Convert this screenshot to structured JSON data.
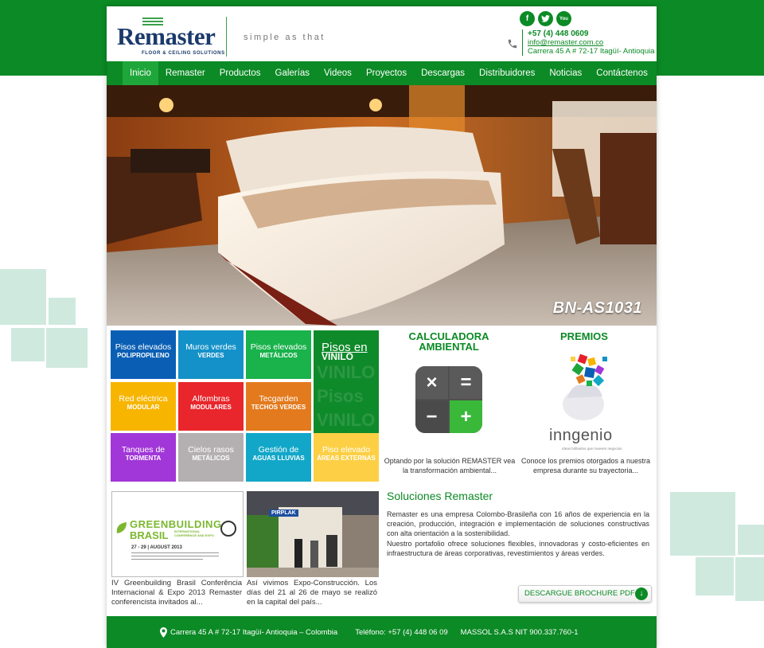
{
  "brand": {
    "name": "Remaster",
    "subtitle": "FLOOR & CEILING SOLUTIONS",
    "tagline": "simple as that"
  },
  "social": [
    {
      "name": "facebook-icon",
      "glyph": "f"
    },
    {
      "name": "twitter-icon",
      "glyph": "t"
    },
    {
      "name": "youtube-icon",
      "glyph": "You"
    }
  ],
  "contact": {
    "phone": "+57 (4) 448 0609",
    "email": "info@remaster.com.co",
    "address": "Carrera 45 A # 72-17 Itagüí- Antioquia"
  },
  "nav": [
    "Inicio",
    "Remaster",
    "Productos",
    "Galerías",
    "Videos",
    "Proyectos",
    "Descargas",
    "Distribuidores",
    "Noticias",
    "Contáctenos"
  ],
  "hero": {
    "caption": "BN-AS1031"
  },
  "tiles": [
    {
      "line1": "Pisos elevados",
      "line2": "POLIPROPILENO",
      "color": "#0a5fb4"
    },
    {
      "line1": "Muros verdes",
      "line2": "VERDES",
      "color": "#1591c9"
    },
    {
      "line1": "Pisos elevados",
      "line2": "METÁLICOS",
      "color": "#19b24b"
    },
    {
      "line1": "Red eléctrica",
      "line2": "MODULAR",
      "color": "#f7b500"
    },
    {
      "line1": "Alfombras",
      "line2": "MODULARES",
      "color": "#e8262b"
    },
    {
      "line1": "Tecgarden",
      "line2": "TECHOS VERDES",
      "color": "#e37a1d"
    },
    {
      "line1": "Tanques de",
      "line2": "TORMENTA",
      "color": "#a137d8"
    },
    {
      "line1": "Cielos rasos",
      "line2": "METÁLICOS",
      "color": "#b4b0b2"
    },
    {
      "line1": "Gestión de",
      "line2": "AGUAS LLUVIAS",
      "color": "#12a7c8"
    },
    {
      "line1": "Piso elevado",
      "line2": "ÁREAS EXTERNAS",
      "color": "#fccf45"
    }
  ],
  "vinilo": {
    "line1": "Pisos en",
    "line2": "VINILO",
    "color": "#0f8a2a"
  },
  "calculadora": {
    "title": "CALCULADORA AMBIENTAL",
    "desc": "Optando por la solución REMASTER vea la transformación ambiental..."
  },
  "premios": {
    "title": "PREMIOS",
    "logo": "inngenio",
    "logo_sub": "Ideas brillantes que mueven negocios",
    "desc": "Conoce los premios otorgados a nuestra empresa durante su trayectoria..."
  },
  "soluciones": {
    "title": "Soluciones Remaster",
    "p1": "Remaster es una empresa Colombo-Brasileña con 16 años de experiencia en la creación, producción, integración e implementación de soluciones constructivas con alta orientación a la sostenibilidad.",
    "p2": "Nuestro portafolio ofrece soluciones flexibles, innovadoras y costo-eficientes en infraestructura de áreas corporativas, revestimientos y áreas verdes."
  },
  "brochure": {
    "label": "DESCARGUE BROCHURE PDF"
  },
  "news": [
    {
      "img_title": "GREENBUILDING",
      "img_sub": "BRASIL",
      "img_badge": "INTERNATIONAL CONFERENCE AND EXPO",
      "img_date": "27 - 29 | AUGUST 2013",
      "text": "IV Greenbuilding Brasil Conferência Internacional & Expo 2013 Remaster conferencista invitados al..."
    },
    {
      "img_sign": "PIRPLAK",
      "text": "Así vivimos Expo-Construcción. Los días del 21 al 26 de mayo se realizó en la capital del país..."
    }
  ],
  "footer": {
    "address": "Carrera 45 A # 72-17 Itagüí- Antioquia – Colombia",
    "phone": "Teléfono: +57 (4) 448 06 09",
    "nit": "MASSOL S.A.S NIT 900.337.760-1"
  },
  "colors": {
    "brand_green": "#0b8a25",
    "navy": "#1b3a6b"
  }
}
